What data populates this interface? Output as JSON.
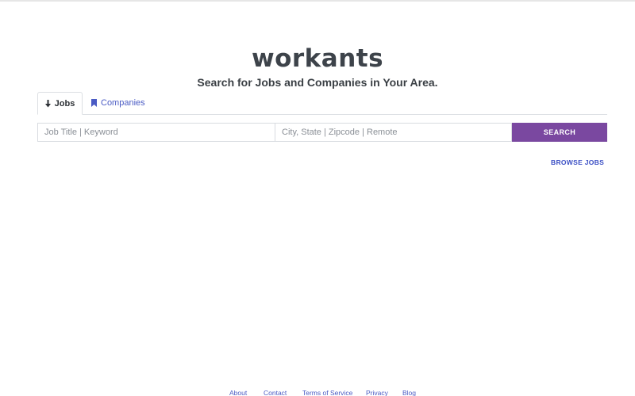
{
  "brand": {
    "logo_text": "workants",
    "tagline": "Search for Jobs and Companies in Your Area."
  },
  "tabs": [
    {
      "label": "Jobs",
      "icon": "download-arrow-icon",
      "active": true
    },
    {
      "label": "Companies",
      "icon": "bookmark-icon",
      "active": false
    }
  ],
  "search": {
    "keyword_placeholder": "Job Title | Keyword",
    "location_placeholder": "City, State | Zipcode | Remote",
    "button_label": "SEARCH"
  },
  "browse_link": "BROWSE JOBS",
  "footer": {
    "links": [
      "About",
      "Contact",
      "Terms of Service",
      "Privacy",
      "Blog"
    ]
  },
  "colors": {
    "accent_purple": "#7a48a0",
    "link_blue": "#4a5bc4",
    "text_dark": "#3d434a"
  }
}
